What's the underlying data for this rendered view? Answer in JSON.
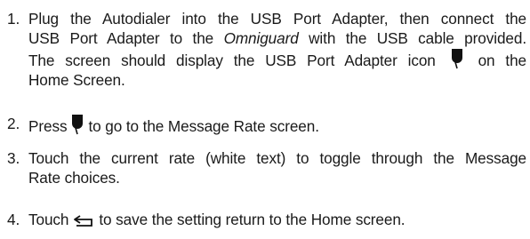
{
  "steps": [
    {
      "number": "1.",
      "line1": "Plug the Autodialer into the USB Port Adapter, then connect the",
      "line2_pre": "USB Port Adapter to the ",
      "line2_em": "Omniguard",
      "line2_post": " with the USB cable provided.",
      "line3_pre": "The screen should display the USB Port Adapter icon",
      "line3_post": "on the",
      "line4": "Home Screen.",
      "icon": "usb-port-adapter-icon"
    },
    {
      "number": "2.",
      "pre": "Press",
      "post": "to go to the Message Rate screen.",
      "icon": "usb-port-adapter-icon"
    },
    {
      "number": "3.",
      "line1": "Touch the current rate (white text) to toggle through the Message",
      "line2": "Rate choices."
    },
    {
      "number": "4.",
      "pre": "Touch",
      "post": "to save the setting return to the Home screen.",
      "icon": "back-arrow-icon"
    }
  ]
}
